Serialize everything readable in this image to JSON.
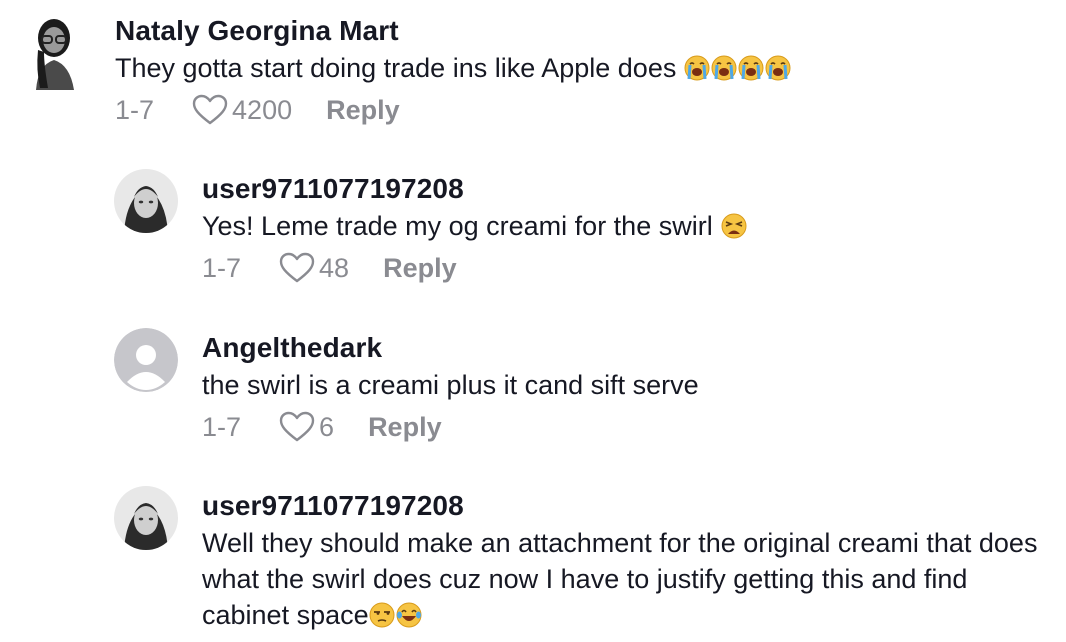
{
  "comments": [
    {
      "username": "Nataly Georgina Mart",
      "text": "They gotta start doing trade ins like Apple does",
      "emojis": [
        "loudly-crying-face",
        "loudly-crying-face",
        "loudly-crying-face",
        "loudly-crying-face"
      ],
      "date": "1-7",
      "likes": "4200",
      "reply_label": "Reply"
    },
    {
      "username": "user9711077197208",
      "text": "Yes! Leme trade my og creami for the swirl",
      "emojis": [
        "weary-face"
      ],
      "date": "1-7",
      "likes": "48",
      "reply_label": "Reply"
    },
    {
      "username": "Angelthedark",
      "text": "the swirl is a creami plus it cand sift serve",
      "emojis": [],
      "date": "1-7",
      "likes": "6",
      "reply_label": "Reply"
    },
    {
      "username": "user9711077197208",
      "text": "Well they should make an attachment for the original creami that does what the swirl does cuz now I have to justify getting this and find cabinet space",
      "emojis": [
        "unamused-face",
        "face-with-tears-of-joy"
      ]
    }
  ],
  "icons": {
    "like": "heart-outline-icon",
    "default_avatar": "default-avatar-icon"
  },
  "colors": {
    "text_primary": "#161823",
    "text_secondary": "#8a8b91",
    "default_avatar_bg": "#c6c6cb"
  }
}
